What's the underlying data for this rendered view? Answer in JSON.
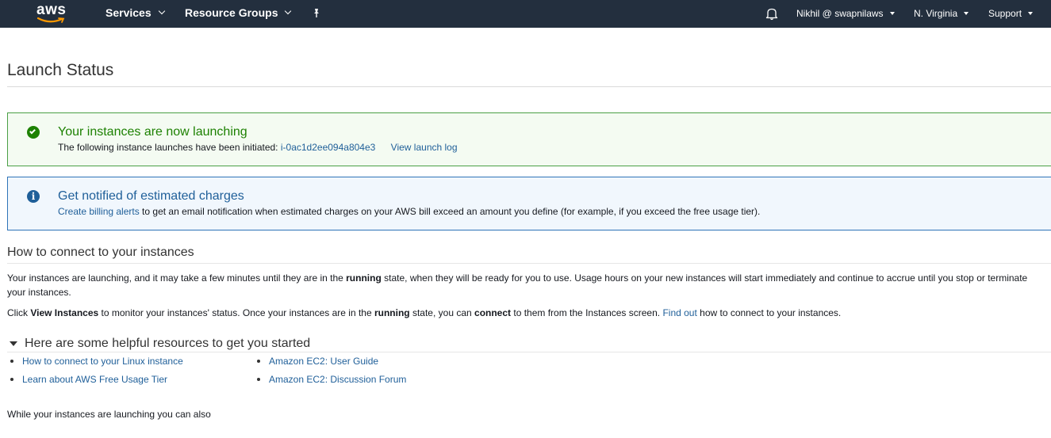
{
  "nav": {
    "logo": "aws",
    "services": "Services",
    "resource_groups": "Resource Groups",
    "user": "Nikhil @ swapnilaws",
    "region": "N. Virginia",
    "support": "Support"
  },
  "page": {
    "title": "Launch Status"
  },
  "success_alert": {
    "title": "Your instances are now launching",
    "body_prefix": "The following instance launches have been initiated:",
    "instance_id": "i-0ac1d2ee094a804e3",
    "view_log": "View launch log"
  },
  "info_alert": {
    "title": "Get notified of estimated charges",
    "link": "Create billing alerts",
    "body": " to get an email notification when estimated charges on your AWS bill exceed an amount you define (for example, if you exceed the free usage tier)."
  },
  "connect": {
    "title": "How to connect to your instances",
    "p1_a": "Your instances are launching, and it may take a few minutes until they are in the ",
    "p1_b": "running",
    "p1_c": " state, when they will be ready for you to use. Usage hours on your new instances will start immediately and continue to accrue until you stop or terminate your instances.",
    "p2_a": "Click ",
    "p2_b": "View Instances",
    "p2_c": " to monitor your instances' status. Once your instances are in the ",
    "p2_d": "running",
    "p2_e": " state, you can ",
    "p2_f": "connect",
    "p2_g": " to them from the Instances screen. ",
    "p2_link": "Find out",
    "p2_h": " how to connect to your instances."
  },
  "resources": {
    "title": "Here are some helpful resources to get you started",
    "left": [
      "How to connect to your Linux instance",
      "Learn about AWS Free Usage Tier"
    ],
    "right": [
      "Amazon EC2: User Guide",
      "Amazon EC2: Discussion Forum"
    ]
  },
  "footer_text": "While your instances are launching you can also"
}
